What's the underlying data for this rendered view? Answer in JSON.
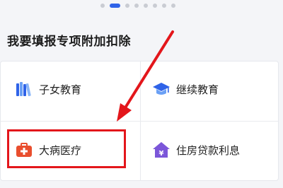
{
  "pager": {
    "count": 8,
    "active_index": 1
  },
  "section": {
    "title": "我要填报专项附加扣除"
  },
  "items": [
    {
      "label": "子女教育",
      "icon": "books-icon"
    },
    {
      "label": "继续教育",
      "icon": "graduation-cap-icon"
    },
    {
      "label": "大病医疗",
      "icon": "medical-kit-icon"
    },
    {
      "label": "住房贷款利息",
      "icon": "house-yuan-icon"
    }
  ],
  "colors": {
    "accent": "#2f63e8",
    "highlight": "#e3161b",
    "icon_blue": "#2f63e8",
    "icon_orange": "#e94e2e",
    "icon_purple": "#7b56d9"
  }
}
